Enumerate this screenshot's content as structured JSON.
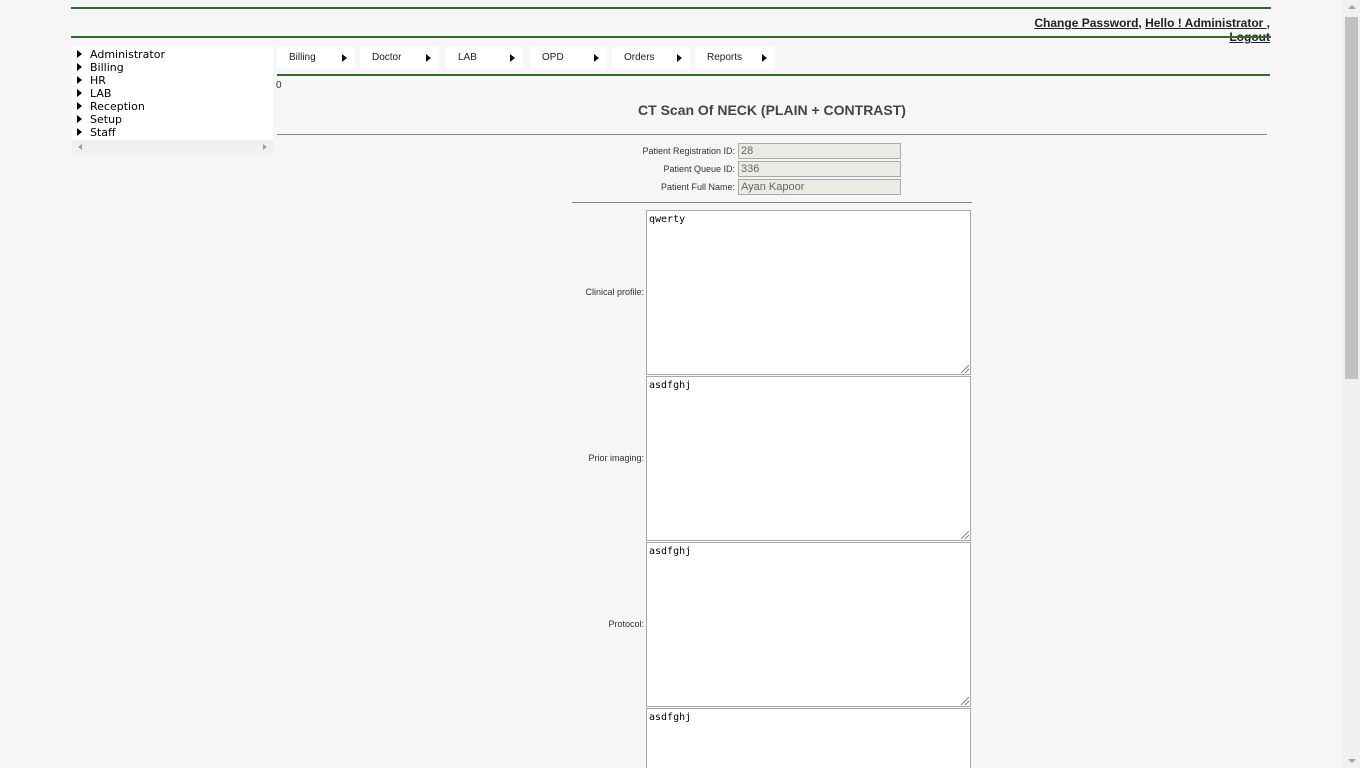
{
  "header": {
    "change_password": "Change Password",
    "separator": ", ",
    "greeting": "Hello ! Administrator ,",
    "logout": "Logout"
  },
  "sidebar": {
    "items": [
      {
        "label": "Administrator"
      },
      {
        "label": "Billing"
      },
      {
        "label": "HR"
      },
      {
        "label": "LAB"
      },
      {
        "label": "Reception"
      },
      {
        "label": "Setup"
      },
      {
        "label": "Staff"
      }
    ]
  },
  "menu": {
    "items": [
      {
        "label": "Billing"
      },
      {
        "label": "Doctor"
      },
      {
        "label": "LAB"
      },
      {
        "label": "OPD"
      },
      {
        "label": "Orders"
      },
      {
        "label": "Reports"
      }
    ]
  },
  "counter": "0",
  "page_title": "CT Scan Of NECK (PLAIN + CONTRAST)",
  "patient": {
    "registration_label": "Patient Registration ID:",
    "registration_value": "28",
    "queue_label": "Patient Queue ID:",
    "queue_value": "336",
    "name_label": "Patient Full Name:",
    "name_value": "Ayan Kapoor"
  },
  "form": {
    "clinical_profile_label": "Clinical profile:",
    "clinical_profile_value": "qwerty",
    "prior_imaging_label": "Prior imaging:",
    "prior_imaging_value": "asdfghj",
    "protocol_label": "Protocol:",
    "protocol_value": "asdfghj",
    "fourth_value": "asdfghj"
  }
}
